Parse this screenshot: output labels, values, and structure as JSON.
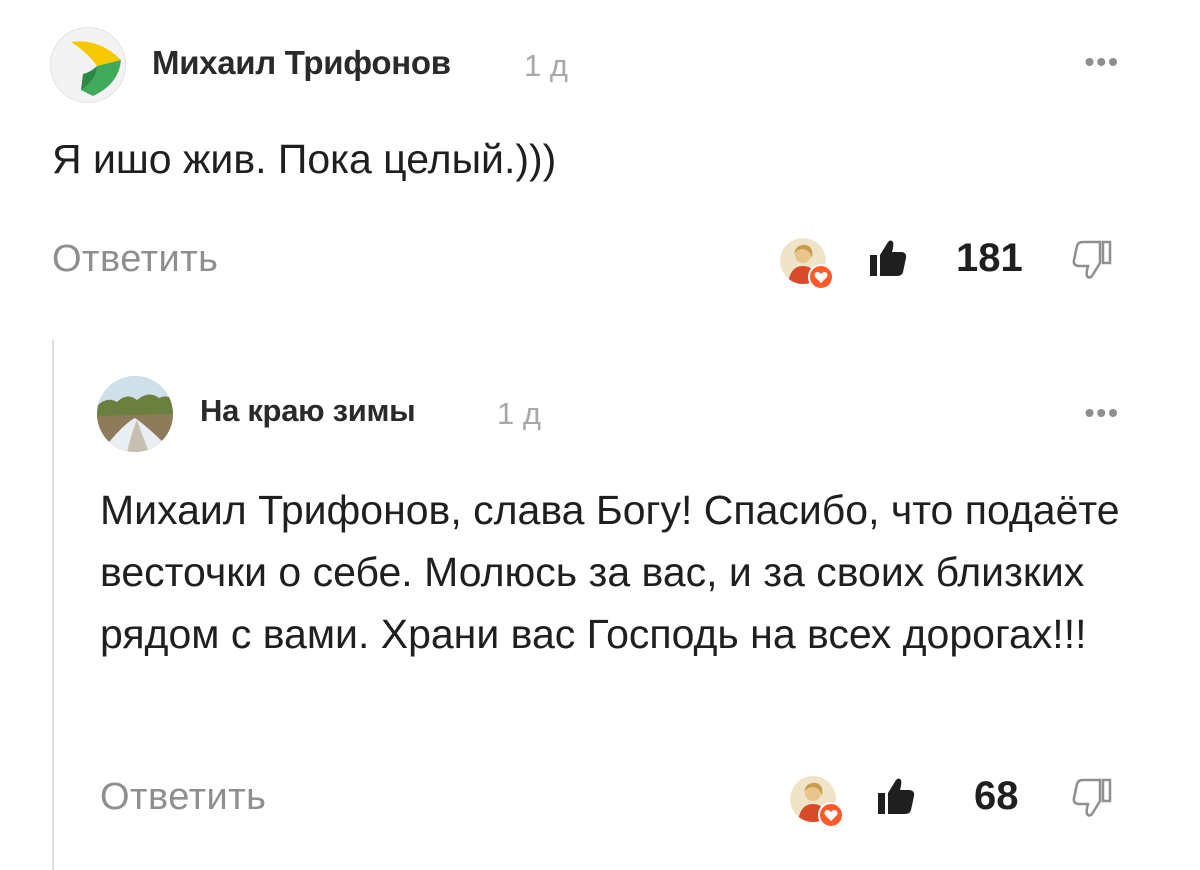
{
  "comments": [
    {
      "author": "Михаил Трифонов",
      "time": "1 д",
      "text": "Я ишо жив. Пока целый.)))",
      "reply_label": "Ответить",
      "likes": "181",
      "avatar": "yellow-green-logo-avatar"
    },
    {
      "author": "На краю зимы",
      "time": "1 д",
      "text": "Михаил Трифонов, слава Богу! Спасибо, что подаёте весточки о себе. Молюсь за вас, и за своих близких рядом с вами. Храни вас Господь на всех дорогах!!!",
      "reply_label": "Ответить",
      "likes": "68",
      "avatar": "winter-road-photo-avatar"
    }
  ],
  "menu_icon": "more-dots-icon",
  "colors": {
    "secondary_text": "#8f8f8f",
    "timestamp": "#a8a8a8",
    "heart_badge": "#ff5a2a",
    "thread_line": "#dcdcdc"
  }
}
